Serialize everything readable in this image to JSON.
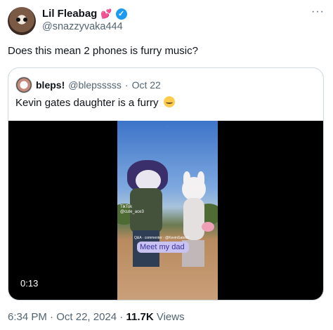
{
  "author": {
    "display_name": "Lil Fleabag",
    "emoji_icon": "heart-icon",
    "handle": "@snazzyvaka444",
    "verified_icon": "verified-badge-icon"
  },
  "tweet_text": "Does this mean 2 phones is furry music?",
  "quoted": {
    "display_name": "bleps!",
    "handle": "@blepsssss",
    "separator": "·",
    "date": "Oct 22",
    "text": "Kevin gates daughter is a furry",
    "emoji_icon": "crying-face-icon",
    "video": {
      "duration": "0:13",
      "sticker_text": "Meet my dad",
      "platform_label": "TikTok",
      "overlay_handle": "@cute_ace3",
      "caption_snippet": "Q&A · commenter · @KevinGates1"
    }
  },
  "meta": {
    "time": "6:34 PM",
    "dot1": "·",
    "date": "Oct 22, 2024",
    "dot2": "·",
    "views_count": "11.7K",
    "views_label": "Views"
  },
  "colors": {
    "accent": "#1d9bf0",
    "secondary_text": "#536471",
    "border": "#cfd9de"
  }
}
